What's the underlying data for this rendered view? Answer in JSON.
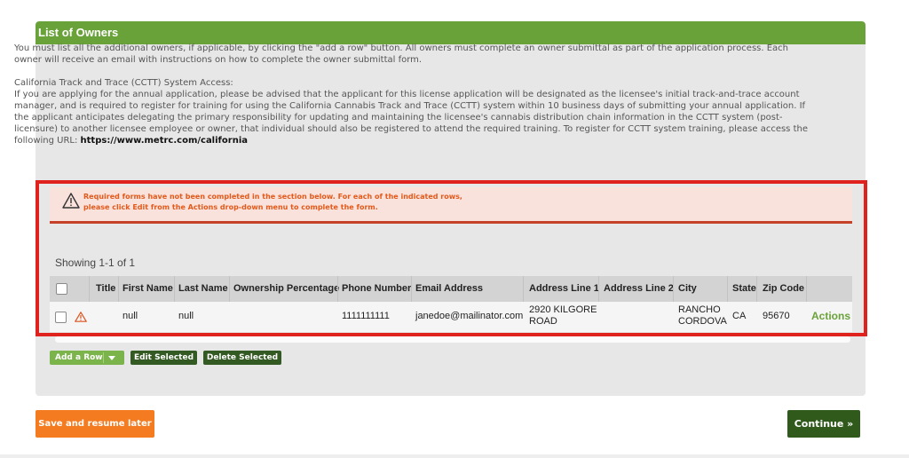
{
  "panel": {
    "title": "List of Owners"
  },
  "intro": {
    "paragraph1": "You must list all the additional owners, if applicable, by clicking the \"add a row\" button. All owners must complete an owner submittal as part of the application process. Each owner will receive an email with instructions on how to complete the owner submittal form.",
    "ccct_heading": "California Track and Trace (CCTT) System Access:",
    "paragraph2": "If you are applying for the annual application, please be advised that the applicant for this license application will be designated as the licensee's initial track-and-trace account manager, and is required to register for training for using the California Cannabis Track and Trace (CCTT) system within 10 business days of submitting your annual application. If the applicant anticipates delegating the primary responsibility for updating and maintaining the licensee's cannabis distribution chain information in the CCTT system (post-licensure) to another licensee employee or owner, that individual should also be registered to attend the required training. To register for CCTT system training, please access the following URL:",
    "url": "https://www.metrc.com/california"
  },
  "alert": {
    "line1": "Required forms have not been completed in the section below. For each of the indicated rows,",
    "line2": "please click Edit from the Actions drop-down menu to complete the form."
  },
  "table": {
    "showing": "Showing 1-1 of 1",
    "headers": {
      "title": "Title",
      "first_name": "First Name",
      "last_name": "Last Name",
      "ownership": "Ownership Percentage",
      "phone": "Phone Number",
      "email": "Email Address",
      "address1": "Address Line 1",
      "address2": "Address Line 2",
      "city": "City",
      "state": "State",
      "zip": "Zip Code"
    },
    "rows": [
      {
        "title": "",
        "first_name": "null",
        "last_name": "null",
        "ownership": "",
        "phone": "1111111111",
        "email": "janedoe@mailinator.com",
        "address1_a": "2920 KILGORE",
        "address1_b": "ROAD",
        "address2": "",
        "city_a": "RANCHO",
        "city_b": "CORDOVA",
        "state": "CA",
        "zip": "95670",
        "actions": "Actions"
      }
    ]
  },
  "buttons": {
    "add_row": "Add a Row",
    "edit_selected": "Edit Selected",
    "delete_selected": "Delete Selected",
    "save_resume": "Save and resume later",
    "continue": "Continue »"
  },
  "colors": {
    "header_green": "#6aa23a",
    "dark_green": "#2f5a1c",
    "orange": "#f47b20",
    "alert_red": "#e0221e"
  }
}
